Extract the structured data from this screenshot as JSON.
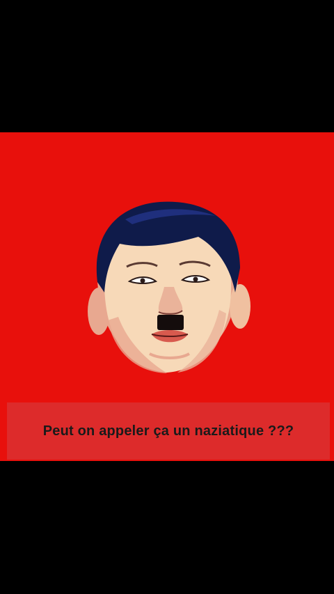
{
  "colors": {
    "background": "#000000",
    "panel_red": "#e8100c",
    "caption_bg": "#dd2b2b",
    "caption_text": "#1a1a1a",
    "hair": "#0f1b4a",
    "skin_light": "#f7d9b8",
    "skin_shadow": "#e8a890",
    "mustache": "#140c0c",
    "lips": "#d85a4e"
  },
  "illustration": {
    "icon": "caricature-face-illustration"
  },
  "caption": {
    "text": "Peut on appeler ça un naziatique ???"
  }
}
